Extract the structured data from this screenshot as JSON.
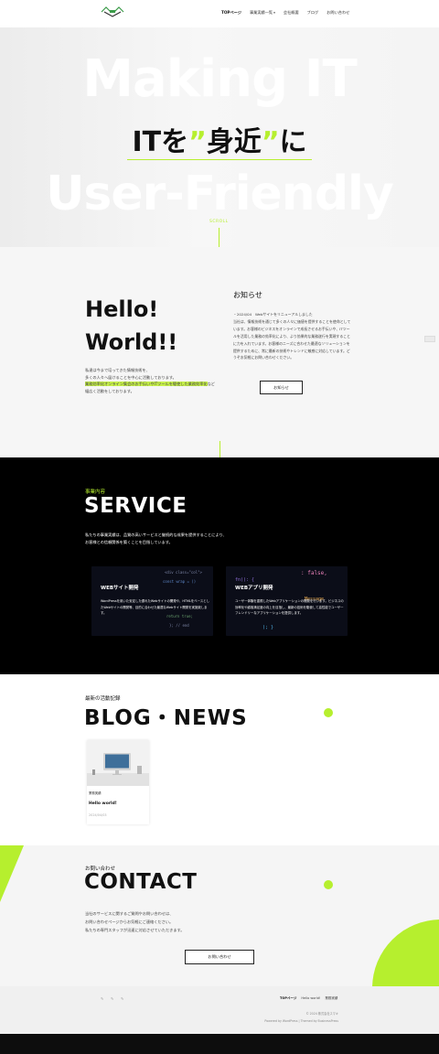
{
  "header": {
    "nav": [
      {
        "label": "TOPページ",
        "active": true
      },
      {
        "label": "事業実績一覧",
        "dropdown": true
      },
      {
        "label": "会社概要"
      },
      {
        "label": "ブログ"
      },
      {
        "label": "お問い合わせ"
      }
    ]
  },
  "hero": {
    "bg_line1": "Making IT",
    "bg_line2": "User-Friendly",
    "catch_pre": "ITを",
    "catch_q1": "”",
    "catch_mid": "身近",
    "catch_q2": "”",
    "catch_post": "に",
    "scroll": "SCROLL"
  },
  "hello": {
    "title_line1": "Hello!",
    "title_line2": "World!!",
    "desc_line1": "私達は今まで培ってきた情報技術を、",
    "desc_line2": "多くの人々へ届けることを中心に活動しております。",
    "desc_highlight": "業務効率化オンライン集会のお手伝いやITツールを駆使した業務効率化",
    "desc_tail": "など",
    "desc_line4": "幅広く活動をしております。"
  },
  "news": {
    "title": "お知らせ",
    "body": "・2024/04　Webサイトをリニューアルしました",
    "body2": "当社は、情報技術を通じて多くの人々に価値を提供することを使命としています。お客様のビジネスをオンラインで成長させるお手伝いや、ITツールを活用した業務の効率化により、より効果的な業務遂行を実現することに力を入れています。お客様のニーズに合わせた最適なソリューションを提供するために、常に最新の技術やトレンドに敏感に対応しています。どうぞお気軽にお問い合わせください。",
    "button": "お知らせ"
  },
  "service": {
    "label": "事業内容",
    "title": "SERVICE",
    "desc_line1": "私たちの事業実績は、品質の高いサービスと継続的な成果を提供することにより、",
    "desc_line2": "お客様との信頼関係を築くことを目指しています。",
    "cards": [
      {
        "title": "WEBサイト開発",
        "text": "WordPressを用いた安定した優れたWebサイトの開発や、HTMLをベースとしたWebサイトの開発等、目的に合わせた最適なWebサイト開発を実施致します。"
      },
      {
        "title": "WEBアプリ開発",
        "text": "ユーザー体験を重視したWebアプリケーションの開発を行います。ビジネスの効率化や顧客満足度の向上を目指し、最新の技術を駆使して高性能でユーザーフレンドリーなアプリケーションを提供します。"
      }
    ]
  },
  "blog": {
    "label": "最新の活動記録",
    "title": "BLOG・NEWS",
    "post": {
      "category": "業務実績",
      "title": "Hello world!",
      "date": "2024/04/03"
    }
  },
  "contact": {
    "label": "お問い合わせ",
    "title": "CONTACT",
    "desc_line1": "当社のサービスに関するご質問やお問い合わせは、",
    "desc_line2": "お問い合わせページからお気軽にご連絡ください。",
    "desc_line3": "私たちの専門スタッフが迅速に対応させていただきます。",
    "button": "お問い合わせ"
  },
  "footer": {
    "nav": [
      "TOPページ",
      "Hello world!",
      "業務実績"
    ],
    "copyright": "© 2024 株式会社スマキ",
    "powered": "Powered by WordPress | Themed by BusinessPress"
  },
  "colors": {
    "accent": "#b6ef2e",
    "dark": "#000000"
  }
}
